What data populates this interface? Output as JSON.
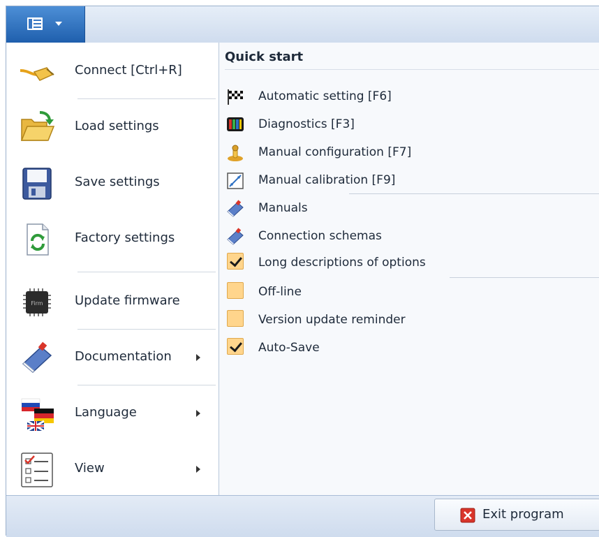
{
  "app_menu": {
    "icon": "list-menu-icon",
    "dropdown_icon": "chevron-down-icon"
  },
  "left_menu": {
    "items": [
      {
        "label": "Connect [Ctrl+R]",
        "icon": "cable-plug-icon"
      },
      {
        "label": "Load settings",
        "icon": "folder-open-icon"
      },
      {
        "label": "Save settings",
        "icon": "floppy-disk-icon"
      },
      {
        "label": "Factory settings",
        "icon": "reset-document-icon"
      },
      {
        "label": "Update firmware",
        "icon": "firmware-chip-icon"
      },
      {
        "label": "Documentation",
        "icon": "book-icon",
        "submenu": true
      },
      {
        "label": "Language",
        "icon": "flags-icon",
        "submenu": true
      },
      {
        "label": "View",
        "icon": "checklist-icon",
        "submenu": true
      }
    ]
  },
  "quick_start": {
    "title": "Quick start",
    "items": [
      {
        "label": "Automatic setting [F6]",
        "icon": "checkered-flag-icon"
      },
      {
        "label": "Diagnostics [F3]",
        "icon": "monitor-icon"
      },
      {
        "label": "Manual configuration [F7]",
        "icon": "joystick-icon"
      },
      {
        "label": "Manual calibration [F9]",
        "icon": "graph-icon"
      },
      {
        "label": "Manuals",
        "icon": "book-icon"
      },
      {
        "label": "Connection schemas",
        "icon": "book-icon"
      }
    ],
    "options": [
      {
        "label": "Long descriptions of options",
        "checked": true
      },
      {
        "label": "Off-line",
        "checked": false
      },
      {
        "label": "Version update reminder",
        "checked": false
      },
      {
        "label": "Auto-Save",
        "checked": true
      }
    ]
  },
  "footer": {
    "exit_label": "Exit program",
    "exit_icon": "close-red-icon"
  },
  "colors": {
    "accent": "#2f72c4",
    "checkbox_fill": "#ffd58c",
    "exit_red": "#d9352a"
  }
}
